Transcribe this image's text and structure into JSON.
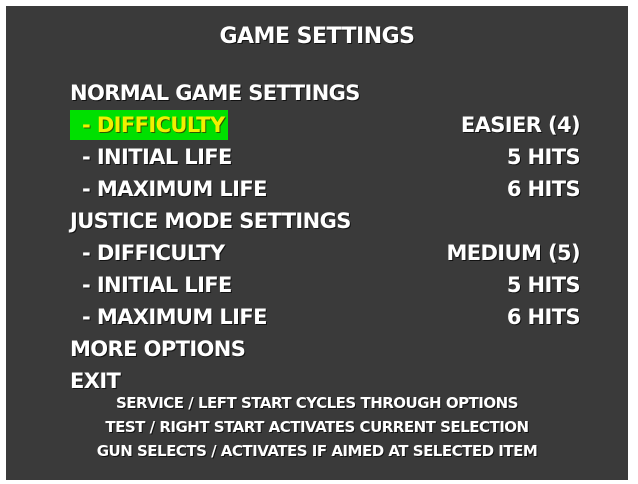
{
  "title": "GAME SETTINGS",
  "colors": {
    "background": "#3a3a3a",
    "text": "#ffffff",
    "highlight_bg": "#00e000",
    "highlight_text": "#f2ef00"
  },
  "menu": {
    "normal_header": "NORMAL GAME SETTINGS",
    "normal": [
      {
        "label": "- DIFFICULTY",
        "value": "EASIER (4)",
        "selected": true
      },
      {
        "label": "- INITIAL LIFE",
        "value": "5 HITS",
        "selected": false
      },
      {
        "label": "- MAXIMUM LIFE",
        "value": "6 HITS",
        "selected": false
      }
    ],
    "justice_header": "JUSTICE MODE SETTINGS",
    "justice": [
      {
        "label": "- DIFFICULTY",
        "value": "MEDIUM (5)",
        "selected": false
      },
      {
        "label": "- INITIAL LIFE",
        "value": "5 HITS",
        "selected": false
      },
      {
        "label": "- MAXIMUM LIFE",
        "value": "6 HITS",
        "selected": false
      }
    ],
    "more_options": "MORE OPTIONS",
    "exit": "EXIT"
  },
  "help": [
    "SERVICE / LEFT START CYCLES THROUGH OPTIONS",
    "TEST / RIGHT START ACTIVATES CURRENT SELECTION",
    "GUN SELECTS / ACTIVATES IF AIMED AT SELECTED ITEM"
  ]
}
